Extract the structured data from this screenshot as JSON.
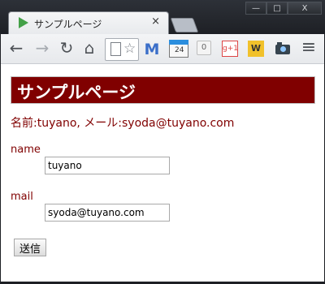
{
  "browser": {
    "tab_title": "サンプルページ",
    "tab_close": "×",
    "window_minimize": "—",
    "window_maximize": "□",
    "window_close": "X"
  },
  "toolbar": {
    "back_icon": "←",
    "forward_icon": "→",
    "reload_icon": "↻",
    "home_icon": "⌂",
    "gmail_icon": "M",
    "calendar_day": "24",
    "counter_badge": "0",
    "gplus_label": "g+1",
    "w_label": "W",
    "menu_icon": "≡"
  },
  "page": {
    "heading": "サンプルページ",
    "message": "名前:tuyano, メール:syoda@tuyano.com",
    "name_label": "name",
    "name_value": "tuyano",
    "mail_label": "mail",
    "mail_value": "syoda@tuyano.com",
    "submit_label": "送信"
  }
}
